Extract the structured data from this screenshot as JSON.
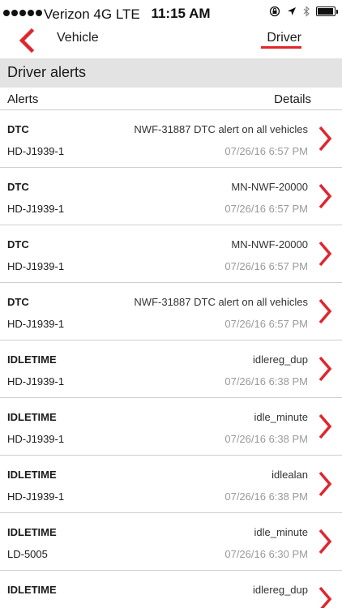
{
  "status_bar": {
    "carrier": "Verizon 4G LTE",
    "time": "11:15 AM",
    "icons": [
      "signal-dots-icon",
      "rotation-lock-icon",
      "location-arrow-icon",
      "bluetooth-icon",
      "battery-icon"
    ]
  },
  "nav": {
    "back_icon": "chevron-left-icon",
    "vehicle_label": "Vehicle",
    "driver_label": "Driver"
  },
  "colors": {
    "accent": "#e0262e",
    "section_bg": "#e3e3e3",
    "time_text": "#9a9a9a"
  },
  "section": {
    "title": "Driver alerts"
  },
  "columns": {
    "alerts": "Alerts",
    "details": "Details"
  },
  "alerts": [
    {
      "type": "DTC",
      "vehicle": "HD-J1939-1",
      "detail": "NWF-31887 DTC alert on all vehicles",
      "time": "07/26/16 6:57 PM"
    },
    {
      "type": "DTC",
      "vehicle": "HD-J1939-1",
      "detail": "MN-NWF-20000",
      "time": "07/26/16 6:57 PM"
    },
    {
      "type": "DTC",
      "vehicle": "HD-J1939-1",
      "detail": "MN-NWF-20000",
      "time": "07/26/16 6:57 PM"
    },
    {
      "type": "DTC",
      "vehicle": "HD-J1939-1",
      "detail": "NWF-31887 DTC alert on all vehicles",
      "time": "07/26/16 6:57 PM"
    },
    {
      "type": "IDLETIME",
      "vehicle": "HD-J1939-1",
      "detail": "idlereg_dup",
      "time": "07/26/16 6:38 PM"
    },
    {
      "type": "IDLETIME",
      "vehicle": "HD-J1939-1",
      "detail": "idle_minute",
      "time": "07/26/16 6:38 PM"
    },
    {
      "type": "IDLETIME",
      "vehicle": "HD-J1939-1",
      "detail": "idlealan",
      "time": "07/26/16 6:38 PM"
    },
    {
      "type": "IDLETIME",
      "vehicle": "LD-5005",
      "detail": "idle_minute",
      "time": "07/26/16 6:30 PM"
    },
    {
      "type": "IDLETIME",
      "vehicle": "",
      "detail": "idlereg_dup",
      "time": ""
    }
  ]
}
